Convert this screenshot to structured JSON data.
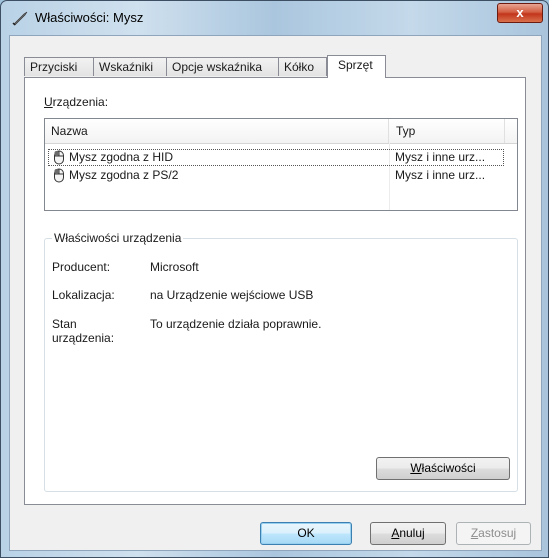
{
  "window": {
    "title": "Właściwości: Mysz",
    "close_glyph": "x"
  },
  "tabs": [
    {
      "label": "Przyciski",
      "active": false
    },
    {
      "label": "Wskaźniki",
      "active": false
    },
    {
      "label": "Opcje wskaźnika",
      "active": false
    },
    {
      "label": "Kółko",
      "active": false
    },
    {
      "label": "Sprzęt",
      "active": true
    }
  ],
  "devices": {
    "label_accel": "U",
    "label_rest": "rządzenia:",
    "columns": {
      "name": "Nazwa",
      "type": "Typ"
    },
    "rows": [
      {
        "name": "Mysz zgodna z HID",
        "type": "Mysz i inne urz...",
        "selected": true
      },
      {
        "name": "Mysz zgodna z PS/2",
        "type": "Mysz i inne urz...",
        "selected": false
      }
    ]
  },
  "properties": {
    "group_title": "Właściwości urządzenia",
    "manufacturer_label": "Producent:",
    "manufacturer_value": "Microsoft",
    "location_label": "Lokalizacja:",
    "location_value": "na Urządzenie wejściowe USB",
    "status_label_line1": "Stan",
    "status_label_line2": "urządzenia:",
    "status_value": "To urządzenie działa poprawnie.",
    "button_accel": "W",
    "button_rest": "łaściwości"
  },
  "footer": {
    "ok": "OK",
    "cancel_accel": "A",
    "cancel_rest": "nuluj",
    "apply_accel": "Z",
    "apply_rest": "astosuj"
  },
  "colors": {
    "client_bg": "#f0f0f0",
    "default_button_border": "#3c7fb1",
    "close_button": "#c2351b"
  },
  "icons": {
    "title": "mouse-cursor-icon",
    "device": "mouse-device-icon",
    "close": "close-icon"
  }
}
